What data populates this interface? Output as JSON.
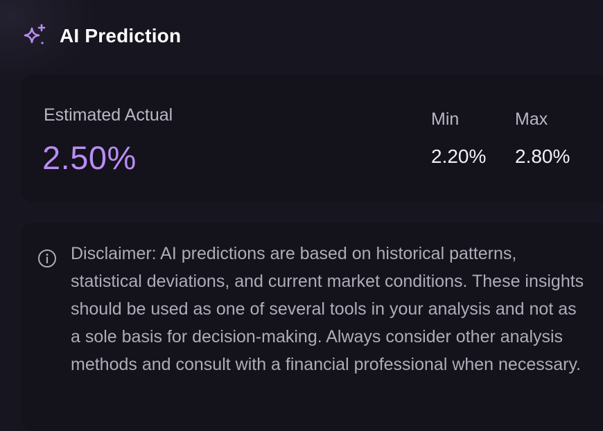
{
  "header": {
    "icon": "sparkle-icon",
    "title": "AI Prediction"
  },
  "estimate": {
    "label": "Estimated Actual",
    "value": "2.50%"
  },
  "range": {
    "min_label": "Min",
    "min_value": "2.20%",
    "max_label": "Max",
    "max_value": "2.80%"
  },
  "disclaimer": {
    "icon": "info-icon",
    "text": "Disclaimer: AI predictions are based on historical patterns, statistical deviations, and current market conditions. These insights should be used as one of several tools in your analysis and not as a sole basis for decision-making. Always consider other analysis methods and consult with a financial professional when necessary."
  },
  "colors": {
    "background": "#17151f",
    "card": "#14121b",
    "accent": "#b98df2",
    "muted_text": "#b9b7c4"
  }
}
